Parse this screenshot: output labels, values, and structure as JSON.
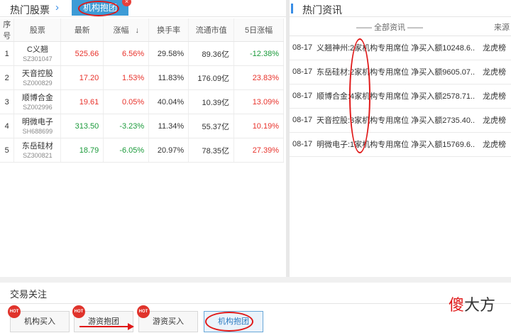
{
  "left_panel": {
    "title": "热门股票",
    "chevron": "›",
    "active_tab": "机构抱团",
    "tab_close": "×",
    "columns": [
      "序号",
      "股票",
      "最新",
      "涨幅",
      "换手率",
      "流通市值",
      "5日涨幅"
    ],
    "sort_arrow": "↓",
    "rows": [
      {
        "no": "1",
        "name": "C义翘",
        "code": "SZ301047",
        "price": "525.66",
        "change": "6.56%",
        "turnover": "29.58%",
        "cap": "89.36亿",
        "five_day": "-12.38%",
        "price_color": "red",
        "change_color": "red",
        "five_color": "green"
      },
      {
        "no": "2",
        "name": "天音控股",
        "code": "SZ000829",
        "price": "17.20",
        "change": "1.53%",
        "turnover": "11.83%",
        "cap": "176.09亿",
        "five_day": "23.83%",
        "price_color": "red",
        "change_color": "red",
        "five_color": "red"
      },
      {
        "no": "3",
        "name": "顺博合金",
        "code": "SZ002996",
        "price": "19.61",
        "change": "0.05%",
        "turnover": "40.04%",
        "cap": "10.39亿",
        "five_day": "13.09%",
        "price_color": "red",
        "change_color": "red",
        "five_color": "red"
      },
      {
        "no": "4",
        "name": "明微电子",
        "code": "SH688699",
        "price": "313.50",
        "change": "-3.23%",
        "turnover": "11.34%",
        "cap": "55.37亿",
        "five_day": "10.19%",
        "price_color": "green",
        "change_color": "green",
        "five_color": "red"
      },
      {
        "no": "5",
        "name": "东岳硅材",
        "code": "SZ300821",
        "price": "18.79",
        "change": "-6.05%",
        "turnover": "20.97%",
        "cap": "78.35亿",
        "five_day": "27.39%",
        "price_color": "green",
        "change_color": "green",
        "five_color": "red"
      }
    ]
  },
  "right_panel": {
    "title": "热门资讯",
    "filter_label": "—— 全部资讯 ——",
    "source_header": "来源",
    "news": [
      {
        "date": "08-17",
        "text": "义翘神州:2家机构专用席位 净买入额10248.6...",
        "source": "龙虎榜"
      },
      {
        "date": "08-17",
        "text": "东岳硅材:2家机构专用席位 净买入额9605.07...",
        "source": "龙虎榜"
      },
      {
        "date": "08-17",
        "text": "顺博合金:4家机构专用席位 净买入额2578.71...",
        "source": "龙虎榜"
      },
      {
        "date": "08-17",
        "text": "天音控股:3家机构专用席位 净买入额2735.40...",
        "source": "龙虎榜"
      },
      {
        "date": "08-17",
        "text": "明微电子:1家机构专用席位 净买入额15769.6...",
        "source": "龙虎榜"
      }
    ]
  },
  "bottom_panel": {
    "title": "交易关注",
    "hot_badge": "HOT",
    "buttons": [
      "机构买入",
      "游资抱团",
      "游资买入",
      "机构抱团"
    ]
  },
  "watermark": {
    "first": "傻",
    "rest": "大方"
  },
  "colors": {
    "accent": "#3d9bd6",
    "up": "#e8322b",
    "down": "#1a9a3a",
    "annotation": "#e01818"
  }
}
